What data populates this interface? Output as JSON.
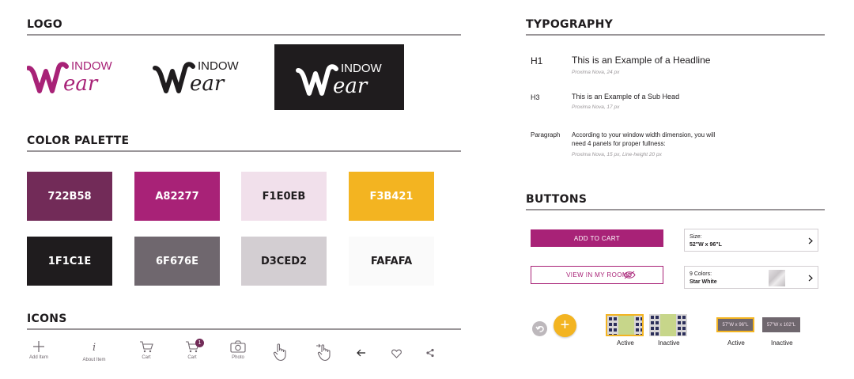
{
  "sections": {
    "logo": "LOGO",
    "color_palette": "COLOR PALETTE",
    "icons": "ICONS",
    "typography": "TYPOGRAPHY",
    "buttons": "BUTTONS"
  },
  "logo": {
    "top_text": "INDOW",
    "bottom_text": "ear",
    "variants": [
      {
        "name": "color",
        "mark_color": "#A82277",
        "background": "#FFFFFF"
      },
      {
        "name": "black",
        "mark_color": "#1F1C1E",
        "background": "#FFFFFF"
      },
      {
        "name": "reversed",
        "mark_color": "#FFFFFF",
        "background": "#1F1C1E"
      }
    ]
  },
  "palette": [
    {
      "hex_label": "722B58",
      "color": "#722B58",
      "text_color": "#FFFFFF"
    },
    {
      "hex_label": "A82277",
      "color": "#A82277",
      "text_color": "#FFFFFF"
    },
    {
      "hex_label": "F1E0EB",
      "color": "#F1E0EB",
      "text_color": "#1F1C1E"
    },
    {
      "hex_label": "F3B421",
      "color": "#F3B421",
      "text_color": "#FFFFFF"
    },
    {
      "hex_label": "1F1C1E",
      "color": "#1F1C1E",
      "text_color": "#FFFFFF"
    },
    {
      "hex_label": "6F676E",
      "color": "#6F676E",
      "text_color": "#FFFFFF"
    },
    {
      "hex_label": "D3CED2",
      "color": "#D3CED2",
      "text_color": "#1F1C1E"
    },
    {
      "hex_label": "FAFAFA",
      "color": "#FAFAFA",
      "text_color": "#1F1C1E"
    }
  ],
  "icons": [
    {
      "icon": "plus-icon",
      "label": "Add Item"
    },
    {
      "icon": "info-icon",
      "label": "About Item"
    },
    {
      "icon": "cart-icon",
      "label": "Cart"
    },
    {
      "icon": "cart-badge-icon",
      "label": "Cart",
      "badge": "1"
    },
    {
      "icon": "camera-icon",
      "label": "Photo"
    },
    {
      "icon": "tap-hand-icon",
      "label": ""
    },
    {
      "icon": "swipe-hand-icon",
      "label": ""
    },
    {
      "icon": "arrow-left-icon",
      "label": ""
    },
    {
      "icon": "heart-icon",
      "label": ""
    },
    {
      "icon": "share-icon",
      "label": ""
    }
  ],
  "typography": {
    "h1": {
      "tag": "H1",
      "text": "This is an Example of a Headline",
      "meta": "Proxima Nova, 24 px"
    },
    "h3": {
      "tag": "H3",
      "text": "This is an Example of a Sub Head",
      "meta": "Proxima Nova, 17 px"
    },
    "paragraph": {
      "tag": "Paragraph",
      "line1": "According to your window width dimension, you will",
      "line2": "need 4 panels for proper fullness:",
      "meta": "Proxima Nova, 15 px, Line-height 20 px"
    }
  },
  "buttons": {
    "add_to_cart": "ADD TO CART",
    "view_in_room": "VIEW IN MY ROOM",
    "size_selector": {
      "label": "Size:",
      "value": "52\"W x 96\"L"
    },
    "color_selector": {
      "label": "9 Colors:",
      "value": "Star White"
    },
    "fab_plus": "+",
    "thumb_states": {
      "active": "Active",
      "inactive": "Inactive"
    },
    "size_chips": {
      "chip_active": "57\"W x 96\"L",
      "chip_inactive": "57\"W x 102\"L",
      "active": "Active",
      "inactive": "Inactive"
    }
  },
  "colors": {
    "accent": "#A82277",
    "dark": "#1F1C1E",
    "yellow": "#F3B421",
    "rule": "#9a9699"
  }
}
